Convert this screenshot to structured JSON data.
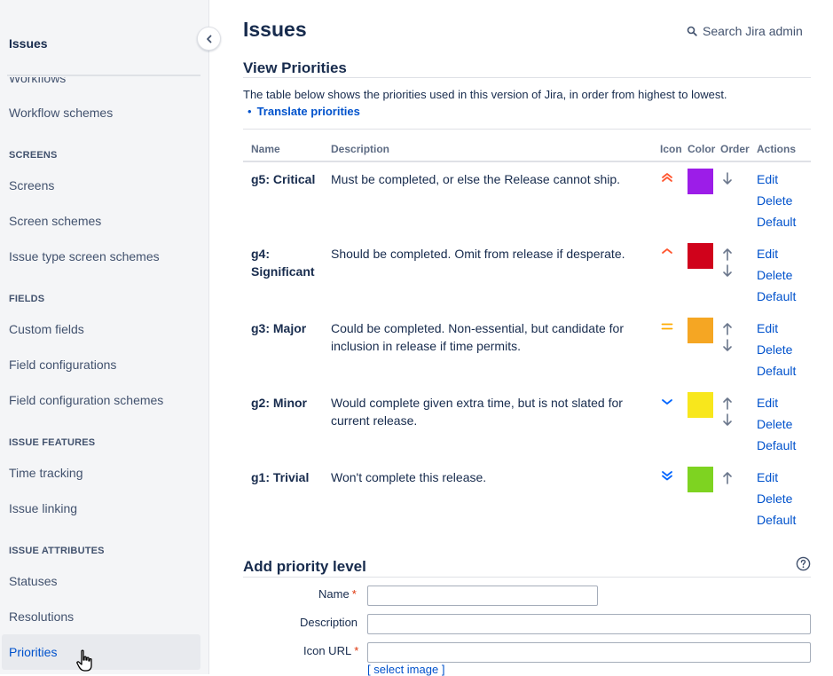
{
  "sidebar": {
    "title": "Issues",
    "partial_item": "Workflows",
    "items_top": [
      {
        "label": "Workflow schemes"
      }
    ],
    "sections": [
      {
        "heading": "SCREENS",
        "items": [
          "Screens",
          "Screen schemes",
          "Issue type screen schemes"
        ]
      },
      {
        "heading": "FIELDS",
        "items": [
          "Custom fields",
          "Field configurations",
          "Field configuration schemes"
        ]
      },
      {
        "heading": "ISSUE FEATURES",
        "items": [
          "Time tracking",
          "Issue linking"
        ]
      },
      {
        "heading": "ISSUE ATTRIBUTES",
        "items": [
          "Statuses",
          "Resolutions",
          "Priorities"
        ]
      }
    ],
    "active_item": "Priorities"
  },
  "header": {
    "title": "Issues",
    "search_label": "Search Jira admin"
  },
  "view_priorities": {
    "title": "View Priorities",
    "description": "The table below shows the priorities used in this version of Jira, in order from highest to lowest.",
    "translate_link": "Translate priorities",
    "columns": {
      "name": "Name",
      "description": "Description",
      "icon": "Icon",
      "color": "Color",
      "order": "Order",
      "actions": "Actions"
    },
    "rows": [
      {
        "name": "g5: Critical",
        "description": "Must be completed, or else the Release cannot ship.",
        "icon": "highest-priority-icon",
        "color": "#9c1de8",
        "can_move_up": false,
        "can_move_down": true
      },
      {
        "name": "g4: Significant",
        "description": "Should be completed. Omit from release if desperate.",
        "icon": "high-priority-icon",
        "color": "#d0021b",
        "can_move_up": true,
        "can_move_down": true
      },
      {
        "name": "g3: Major",
        "description": "Could be completed. Non-essential, but candidate for inclusion in release if time permits.",
        "icon": "medium-priority-icon",
        "color": "#f5a623",
        "can_move_up": true,
        "can_move_down": true
      },
      {
        "name": "g2: Minor",
        "description": "Would complete given extra time, but is not slated for current release.",
        "icon": "low-priority-icon",
        "color": "#f8e71c",
        "can_move_up": true,
        "can_move_down": true
      },
      {
        "name": "g1: Trivial",
        "description": "Won't complete this release.",
        "icon": "lowest-priority-icon",
        "color": "#7ed321",
        "can_move_up": true,
        "can_move_down": false
      }
    ],
    "actions": {
      "edit": "Edit",
      "delete": "Delete",
      "default": "Default"
    }
  },
  "add_priority": {
    "title": "Add priority level",
    "name_label": "Name",
    "description_label": "Description",
    "icon_url_label": "Icon URL",
    "required_mark": "*",
    "name_value": "",
    "description_value": "",
    "icon_url_value": "",
    "select_image_link": "[ select image ]"
  },
  "colors": {
    "link": "#0052cc",
    "text": "#172b4d",
    "sidebar_bg": "#f4f5f7",
    "icon_high": "#ff5630",
    "icon_medium": "#ffab00",
    "icon_low": "#0065ff"
  }
}
